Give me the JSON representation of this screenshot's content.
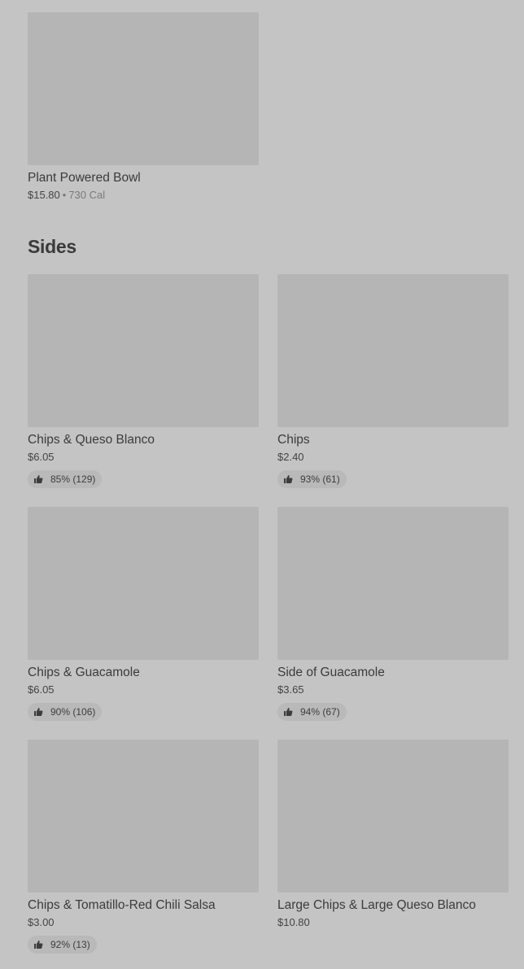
{
  "top_item": {
    "name": "Plant Powered Bowl",
    "price": "$15.80",
    "separator": "•",
    "calories": "730 Cal"
  },
  "sides": {
    "title": "Sides",
    "items": [
      {
        "name": "Chips & Queso Blanco",
        "price": "$6.05",
        "rating": "85% (129)"
      },
      {
        "name": "Chips",
        "price": "$2.40",
        "rating": "93% (61)"
      },
      {
        "name": "Chips & Guacamole",
        "price": "$6.05",
        "rating": "90% (106)"
      },
      {
        "name": "Side of Guacamole",
        "price": "$3.65",
        "rating": "94% (67)"
      },
      {
        "name": "Chips & Tomatillo-Red Chili Salsa",
        "price": "$3.00",
        "rating": "92% (13)"
      },
      {
        "name": "Large Chips & Large Queso Blanco",
        "price": "$10.80",
        "rating": null
      }
    ]
  },
  "icons": {
    "rating": "thumbs-up-icon"
  }
}
